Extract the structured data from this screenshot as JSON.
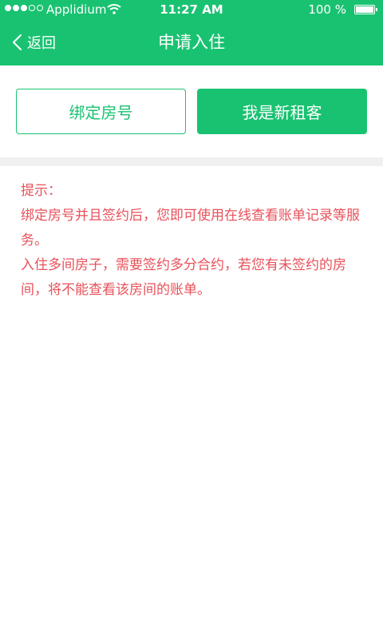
{
  "status_bar": {
    "carrier": "Applidium",
    "time": "11:27 AM",
    "battery": "100 %",
    "signal_icon": "signal-dots-icon",
    "wifi_icon": "wifi-icon",
    "battery_icon": "battery-icon"
  },
  "nav": {
    "back_label": "返回",
    "back_icon": "chevron-left-icon",
    "title": "申请入住"
  },
  "actions": {
    "bind_room_label": "绑定房号",
    "new_tenant_label": "我是新租客"
  },
  "tips": {
    "heading": "提示：",
    "line1": "绑定房号并且签约后，您即可使用在线查看账单记录等服务。",
    "line2": "入住多间房子，需要签约多分合约，若您有未签约的房间，将不能查看该房间的账单。"
  },
  "colors": {
    "brand_green": "#19c271",
    "tip_red": "#e8515a",
    "band_gray": "#f0f0f0"
  }
}
